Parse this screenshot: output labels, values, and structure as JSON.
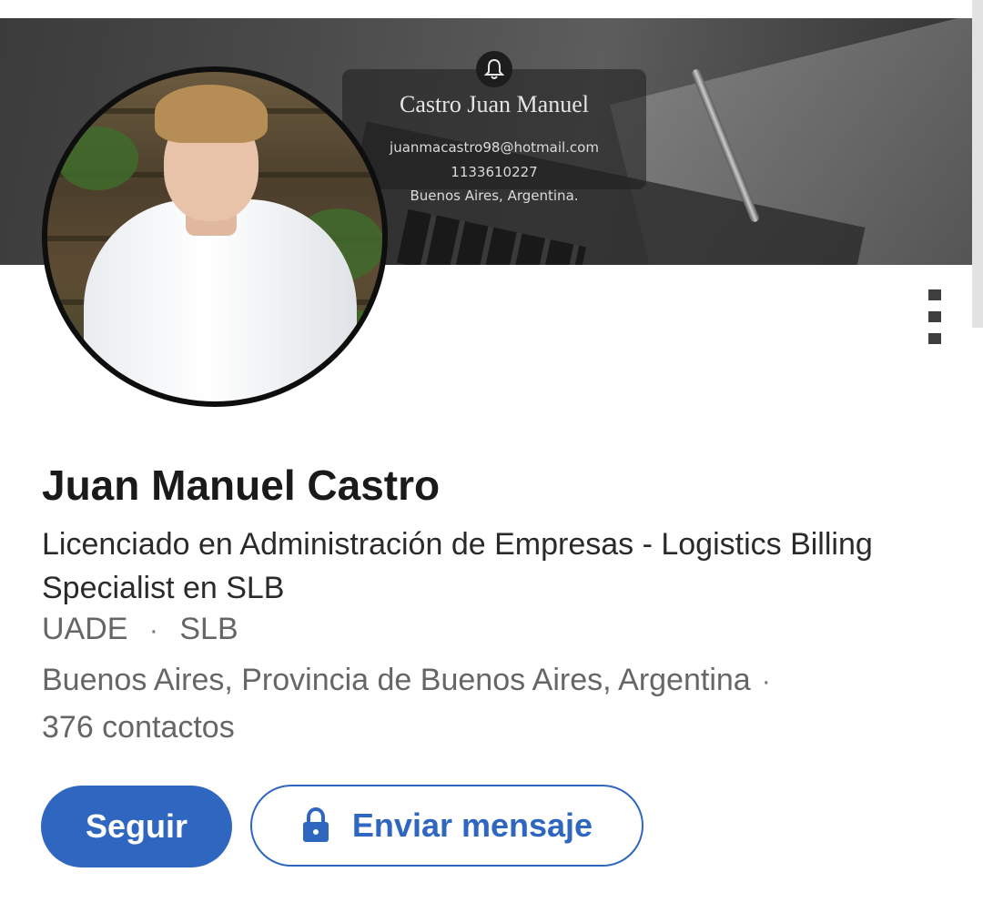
{
  "banner": {
    "card_name": "Castro Juan Manuel",
    "card_email": "juanmacastro98@hotmail.com",
    "card_phone": "1133610227",
    "card_location": "Buenos Aires, Argentina.",
    "bell_icon": "bell-icon"
  },
  "profile": {
    "name": "Juan Manuel Castro",
    "headline": "Licenciado en Administración de Empresas - Logistics Billing Specialist en SLB",
    "education": "UADE",
    "company": "SLB",
    "location": "Buenos Aires, Provincia de Buenos Aires, Argentina",
    "separator": "·",
    "contacts": "376 contactos"
  },
  "actions": {
    "follow_label": "Seguir",
    "message_label": "Enviar mensaje",
    "message_icon": "lock-icon",
    "more_icon": "more-vertical-icon"
  },
  "colors": {
    "accent": "#2f66c0",
    "text_primary": "#1a1a1a",
    "text_secondary": "#666666"
  }
}
